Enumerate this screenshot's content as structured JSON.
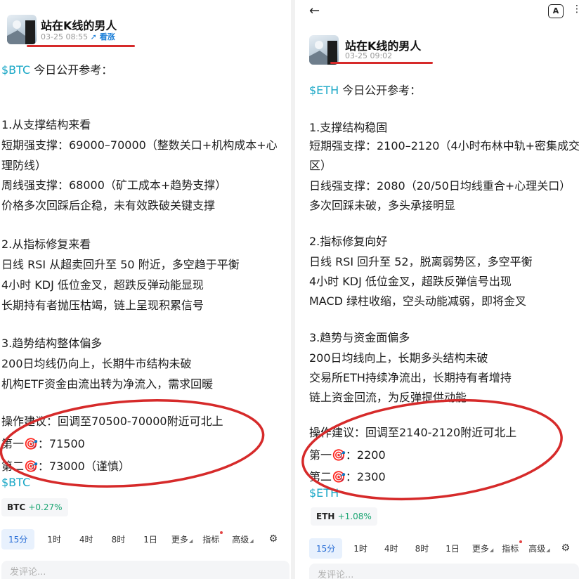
{
  "left": {
    "author": "站在K线的男人",
    "time": "03-25 08:55",
    "tag": "看涨",
    "post_lines": [
      "$BTC 今日公开参考：",
      "1.从支撑结构来看",
      "短期强支撑：69000–70000（整数关口+机构成本+心",
      "理防线）",
      "周线强支撑：68000（矿工成本+趋势支撑）",
      "价格多次回踩后企稳，未有效跌破关键支撑",
      "2.从指标修复来看",
      "日线 RSI 从超卖回升至 50 附近，多空趋于平衡",
      "4小时 KDJ 低位金叉，超跌反弹动能显现",
      "长期持有者抛压枯竭，链上呈现积累信号",
      "3.趋势结构整体偏多",
      "200日均线仍向上，长期牛市结构未破",
      "机构ETF资金由流出转为净流入，需求回暖",
      "操作建议：回调至70500-70000附近可北上",
      "第一🎯：71500",
      "第二🎯：73000（谨慎）",
      "$BTC"
    ],
    "ticker": {
      "symbol": "BTC",
      "change": "+0.27%"
    },
    "tabs": [
      "15分",
      "1时",
      "4时",
      "8时",
      "1日",
      "更多",
      "指标",
      "高级"
    ],
    "comment_placeholder": "发评论..."
  },
  "right": {
    "author": "站在K线的男人",
    "time": "03-25 09:02",
    "post_lines": [
      "$ETH 今日公开参考：",
      "1.支撑结构稳固",
      "短期强支撑：2100–2120（4小时布林中轨+密集成交",
      "区）",
      "日线强支撑：2080（20/50日均线重合+心理关口）",
      "多次回踩未破，多头承接明显",
      "2.指标修复向好",
      "日线 RSI 回升至 52，脱离弱势区，多空平衡",
      "4小时 KDJ 低位金叉，超跌反弹信号出现",
      "MACD 绿柱收缩，空头动能减弱，即将金叉",
      "3.趋势与资金面偏多",
      "200日均线向上，长期多头结构未破",
      "交易所ETH持续净流出，长期持有者增持",
      "链上资金回流，为反弹提供动能",
      "操作建议：回调至2140-2120附近可北上",
      "第一🎯：2200",
      "第二🎯：2300",
      "$ETH"
    ],
    "ticker": {
      "symbol": "ETH",
      "change": "+1.08%"
    },
    "tabs": [
      "15分",
      "1时",
      "4时",
      "8时",
      "1日",
      "更多",
      "指标",
      "高级"
    ],
    "comment_placeholder": "发评论..."
  },
  "colors": {
    "accent": "#19a7c6",
    "annotation": "#d62a2a",
    "positive": "#1aa572",
    "tab_active": "#2a6fd6"
  },
  "icons": [
    "back-arrow-icon",
    "translate-icon",
    "share-icon",
    "chart-settings-icon",
    "target-emoji-icon"
  ]
}
